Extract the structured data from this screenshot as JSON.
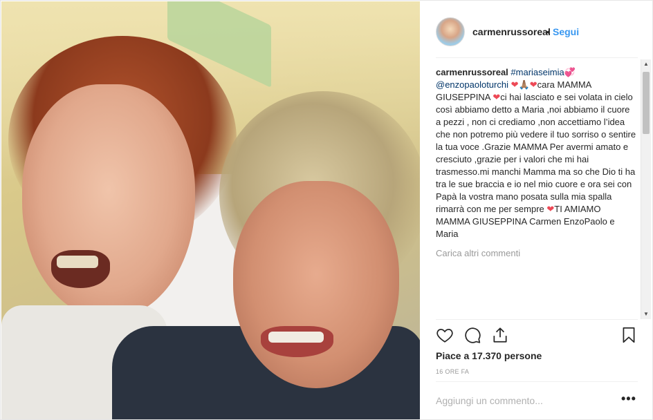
{
  "post": {
    "username": "carmenrussoreal",
    "separator": "•",
    "follow_label": "Segui",
    "caption": {
      "user": "carmenrussoreal",
      "hashtag": "#mariaseimia",
      "emoji_after_hashtag": "💞",
      "mention": "@enzopaoloturchi",
      "emoji_after_mention": "❤🙏🏽❤",
      "text_part1": "cara MAMMA GIUSEPPINA ",
      "emoji_mid": "❤",
      "text_part2": "ci hai lasciato e sei volata in cielo così abbiamo detto a Maria ,noi abbiamo il cuore a pezzi , non ci crediamo ,non accettiamo l’idea che non potremo più vedere il tuo sorriso o sentire la tua voce .Grazie MAMMA Per avermi amato e cresciuto ,grazie per i valori che mi hai trasmesso.mi manchi Mamma ma so che Dio ti ha tra le sue braccia e io nel mio cuore e ora sei con Papà la vostra mano posata sulla mia spalla rimarrà con me per sempre ",
      "emoji_end": "❤",
      "text_part3": "TI AMIAMO MAMMA GIUSEPPINA Carmen EnzoPaolo e Maria"
    },
    "load_more_label": "Carica altri commenti",
    "likes_text": "Piace a 17.370 persone",
    "timestamp": "16 ORE FA",
    "comment_placeholder": "Aggiungi un commento...",
    "more_options": "•••",
    "icons": [
      "heart-icon",
      "comment-icon",
      "share-icon",
      "bookmark-icon"
    ],
    "colors": {
      "link": "#3897f0",
      "tag": "#003569",
      "heart": "#ed4956"
    }
  }
}
